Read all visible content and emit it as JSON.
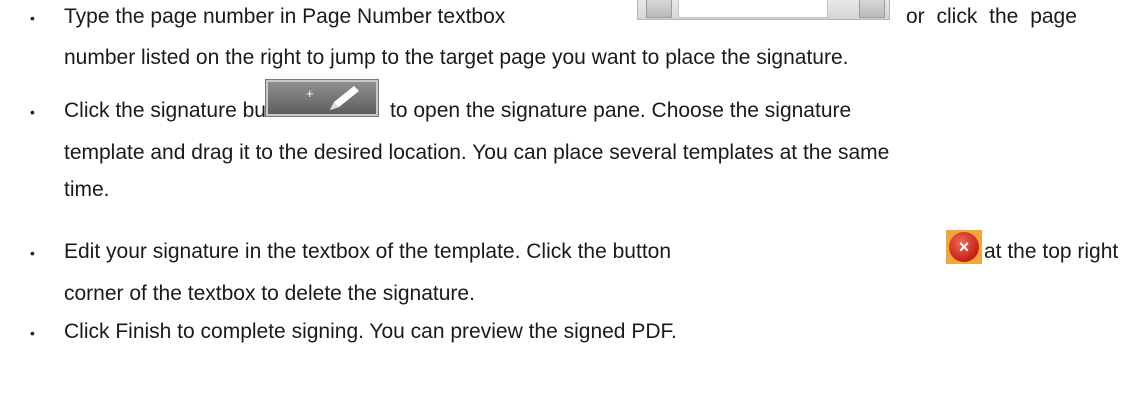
{
  "items": [
    {
      "line1_parts": [
        "Type the page number in Page Number textbox",
        "or click the page"
      ],
      "line2": "number listed on the right to jump to the target page you want to place the signature."
    },
    {
      "line1_parts": [
        "Click the signature button",
        "to open the signature pane. Choose the signature"
      ],
      "line2": "template and drag it to the desired location. You can place several templates at the same",
      "line3": "time."
    },
    {
      "line1_parts": [
        "Edit your signature in the textbox of the template. Click the button",
        "at the top right"
      ],
      "line2": "corner of the textbox to delete the signature."
    },
    {
      "line1": "Click Finish to complete signing. You can preview the signed PDF."
    }
  ],
  "icons": {
    "page_number_textbox": "page-number-textbox-image",
    "signature_button": "signature-button-image",
    "signature_button_plus": "+",
    "delete_button": "delete-button-image",
    "delete_button_glyph": "×",
    "delete_color": "#d0281a",
    "delete_bg": "#f2a73a"
  },
  "bullet_glyph": "•"
}
